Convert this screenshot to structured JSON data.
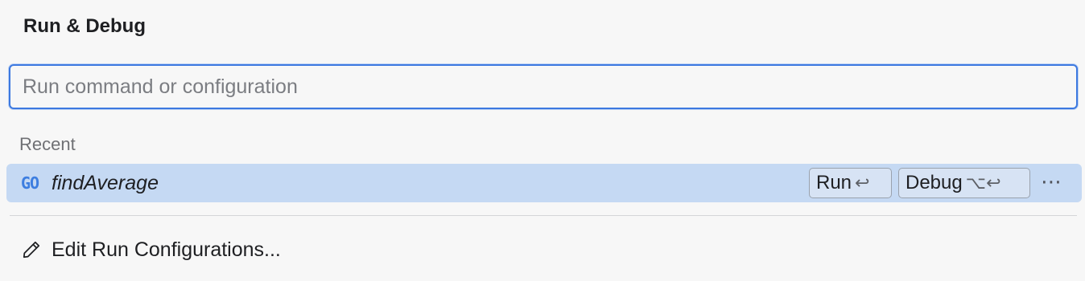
{
  "popup": {
    "title": "Run & Debug"
  },
  "search": {
    "placeholder": "Run command or configuration",
    "value": ""
  },
  "recent": {
    "section_label": "Recent",
    "items": [
      {
        "icon": "go-icon",
        "icon_text": "GO",
        "name": "findAverage",
        "run_label": "Run",
        "run_shortcut": "↩",
        "debug_label": "Debug",
        "debug_shortcut": "⌥↩",
        "more_label": "⋯"
      }
    ]
  },
  "footer": {
    "icon": "pencil-icon",
    "edit_label": "Edit Run Configurations..."
  },
  "colors": {
    "accent": "#3d79e0",
    "selection": "#c5d9f3",
    "background": "#f7f7f7",
    "go_icon": "#3d7ee0"
  }
}
